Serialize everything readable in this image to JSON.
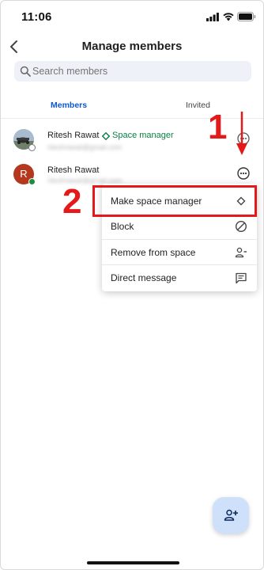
{
  "status_bar": {
    "time": "11:06"
  },
  "header": {
    "title": "Manage members"
  },
  "search": {
    "placeholder": "Search members"
  },
  "tabs": [
    {
      "label": "Members",
      "active": true
    },
    {
      "label": "Invited",
      "active": false
    }
  ],
  "members": [
    {
      "name": "Ritesh Rawat",
      "role": "Space manager",
      "email": "riteshrawat@gmail.com",
      "avatar": "photo",
      "presence": "away"
    },
    {
      "name": "Ritesh Rawat",
      "role": "",
      "email": "riteshrawat@gmail.com",
      "avatar_letter": "R",
      "presence": "active"
    }
  ],
  "context_menu": {
    "items": [
      {
        "label": "Make space manager",
        "icon": "diamond-outline-icon"
      },
      {
        "label": "Block",
        "icon": "block-icon"
      },
      {
        "label": "Remove from space",
        "icon": "remove-person-icon"
      },
      {
        "label": "Direct message",
        "icon": "message-icon"
      }
    ]
  },
  "annotations": {
    "step_1": "1",
    "step_2": "2"
  },
  "colors": {
    "accent": "#0b57d0",
    "manager_green": "#0b8043",
    "annotation_red": "#e6191a",
    "fab_bg": "#cfe0fb"
  }
}
